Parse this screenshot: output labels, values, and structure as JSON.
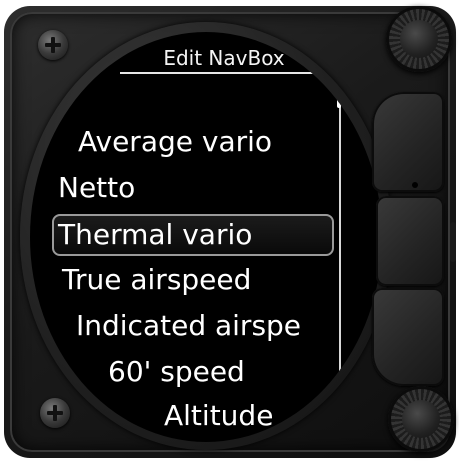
{
  "header": {
    "title": "Edit NavBox"
  },
  "menu": {
    "items": [
      {
        "label": "Average vario"
      },
      {
        "label": "Netto"
      },
      {
        "label": "Thermal vario",
        "selected": true
      },
      {
        "label": "True airspeed"
      },
      {
        "label": "Indicated airspe"
      },
      {
        "label": "60' speed"
      },
      {
        "label": "Altitude"
      }
    ]
  },
  "colors": {
    "screen_bg": "#000000",
    "text": "#ffffff",
    "selection_border": "#9a9a9a",
    "bezel": "#1e1e1e"
  },
  "icons": {
    "screw_top_left": "phillips-screw-icon",
    "screw_bottom_left": "phillips-screw-icon",
    "knob_top": "rotary-knob-icon",
    "knob_bottom": "rotary-knob-icon"
  }
}
